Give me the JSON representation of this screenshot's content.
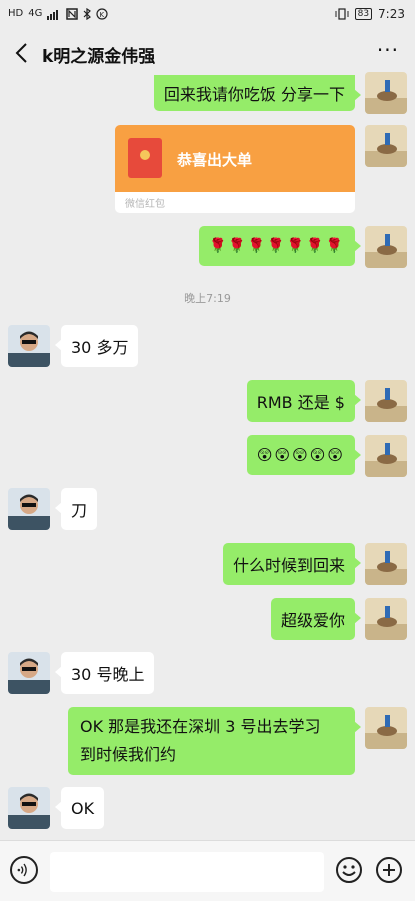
{
  "status_bar": {
    "left_icons": [
      "HD",
      "4G",
      "signal",
      "N",
      "bluetooth",
      "K"
    ],
    "battery": "83",
    "time": "7:23"
  },
  "header": {
    "title": "k明之源金伟强",
    "more": "···"
  },
  "messages": {
    "m1": "回来我请你吃饭  分享一下",
    "redpacket_title": "恭喜出大单",
    "redpacket_footer": "微信红包",
    "m3": "🌹🌹🌹🌹🌹🌹🌹",
    "time1": "晚上7:19",
    "m4": "30 多万",
    "m5": "RMB  还是  $",
    "m6": "😲😲😲😲😲",
    "m7": "刀",
    "m8": "什么时候到回来",
    "m9": "超级爱你",
    "m10": "30 号晚上",
    "m11_line1": "OK  那是我还在深圳  3 号出去学习",
    "m11_line2": "到时候我们约",
    "m12": "OK"
  },
  "colors": {
    "chat_bg": "#ededed",
    "my_bubble": "#95ec69",
    "their_bubble": "#ffffff",
    "redpacket": "#f8a042"
  }
}
